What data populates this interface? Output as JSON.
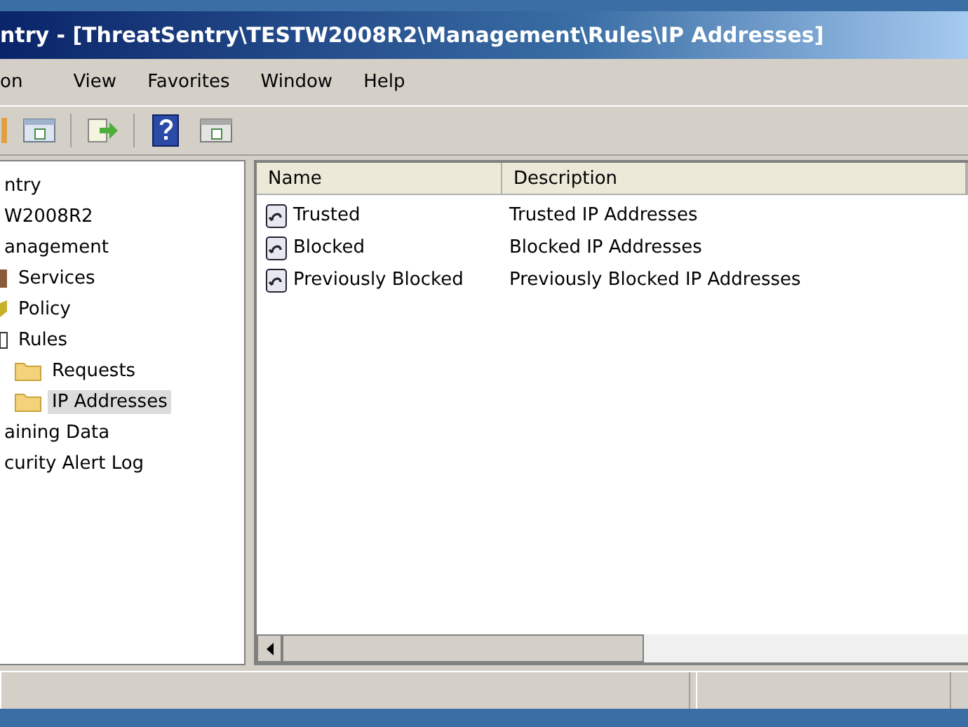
{
  "window": {
    "title": "ntry - [ThreatSentry\\TESTW2008R2\\Management\\Rules\\IP Addresses]"
  },
  "menu": [
    "on",
    "View",
    "Favorites",
    "Window",
    "Help"
  ],
  "tree": [
    {
      "label": "ntry",
      "selected": false,
      "children": [
        {
          "label": "W2008R2",
          "selected": false,
          "children": [
            {
              "label": "anagement",
              "selected": false,
              "children": [
                {
                  "label": "Services",
                  "selected": false,
                  "kind": "services"
                },
                {
                  "label": "Policy",
                  "selected": false,
                  "kind": "policy"
                },
                {
                  "label": "Rules",
                  "selected": false,
                  "kind": "rules",
                  "children": [
                    {
                      "label": "Requests",
                      "selected": false,
                      "kind": "folder"
                    },
                    {
                      "label": "IP Addresses",
                      "selected": true,
                      "kind": "folder"
                    }
                  ]
                }
              ]
            },
            {
              "label": "aining Data",
              "selected": false
            },
            {
              "label": "curity Alert Log",
              "selected": false
            }
          ]
        }
      ]
    }
  ],
  "list": {
    "columns": [
      "Name",
      "Description"
    ],
    "rows": [
      {
        "name": "Trusted",
        "description": "Trusted IP Addresses"
      },
      {
        "name": "Blocked",
        "description": "Blocked IP Addresses"
      },
      {
        "name": "Previously Blocked",
        "description": "Previously Blocked IP Addresses"
      }
    ]
  }
}
